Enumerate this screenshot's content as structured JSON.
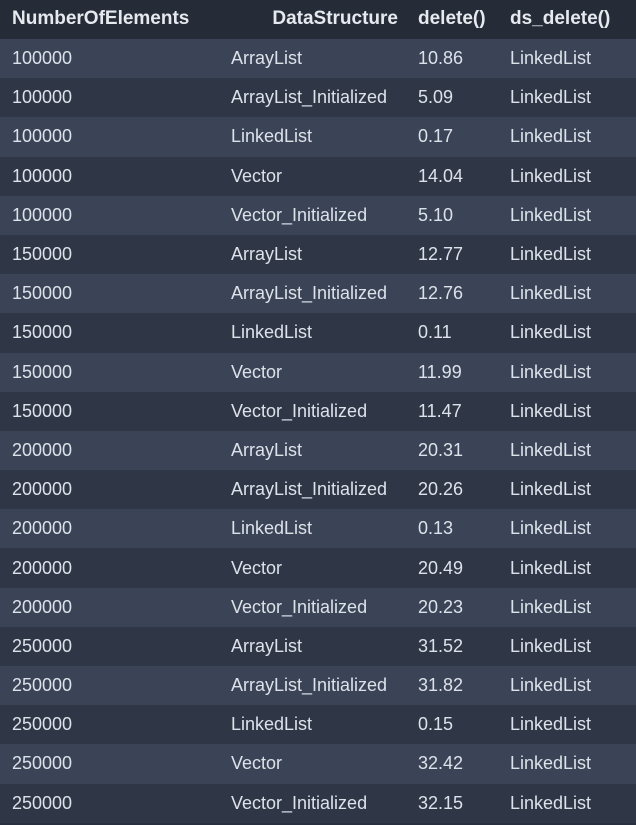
{
  "table": {
    "headers": [
      "NumberOfElements",
      "DataStructure",
      "delete()",
      "ds_delete()"
    ],
    "rows": [
      [
        "100000",
        "ArrayList",
        "10.86",
        "LinkedList"
      ],
      [
        "100000",
        "ArrayList_Initialized",
        "5.09",
        "LinkedList"
      ],
      [
        "100000",
        "LinkedList",
        "0.17",
        "LinkedList"
      ],
      [
        "100000",
        "Vector",
        "14.04",
        "LinkedList"
      ],
      [
        "100000",
        "Vector_Initialized",
        "5.10",
        "LinkedList"
      ],
      [
        "150000",
        "ArrayList",
        "12.77",
        "LinkedList"
      ],
      [
        "150000",
        "ArrayList_Initialized",
        "12.76",
        "LinkedList"
      ],
      [
        "150000",
        "LinkedList",
        "0.11",
        "LinkedList"
      ],
      [
        "150000",
        "Vector",
        "11.99",
        "LinkedList"
      ],
      [
        "150000",
        "Vector_Initialized",
        "11.47",
        "LinkedList"
      ],
      [
        "200000",
        "ArrayList",
        "20.31",
        "LinkedList"
      ],
      [
        "200000",
        "ArrayList_Initialized",
        "20.26",
        "LinkedList"
      ],
      [
        "200000",
        "LinkedList",
        "0.13",
        "LinkedList"
      ],
      [
        "200000",
        "Vector",
        "20.49",
        "LinkedList"
      ],
      [
        "200000",
        "Vector_Initialized",
        "20.23",
        "LinkedList"
      ],
      [
        "250000",
        "ArrayList",
        "31.52",
        "LinkedList"
      ],
      [
        "250000",
        "ArrayList_Initialized",
        "31.82",
        "LinkedList"
      ],
      [
        "250000",
        "LinkedList",
        "0.15",
        "LinkedList"
      ],
      [
        "250000",
        "Vector",
        "32.42",
        "LinkedList"
      ],
      [
        "250000",
        "Vector_Initialized",
        "32.15",
        "LinkedList"
      ]
    ]
  },
  "colors": {
    "header_bg": "#252c38",
    "row_odd": "#3b4456",
    "row_even": "#2f3747",
    "text": "#dde2ea",
    "header_text": "#e6e9ee"
  }
}
